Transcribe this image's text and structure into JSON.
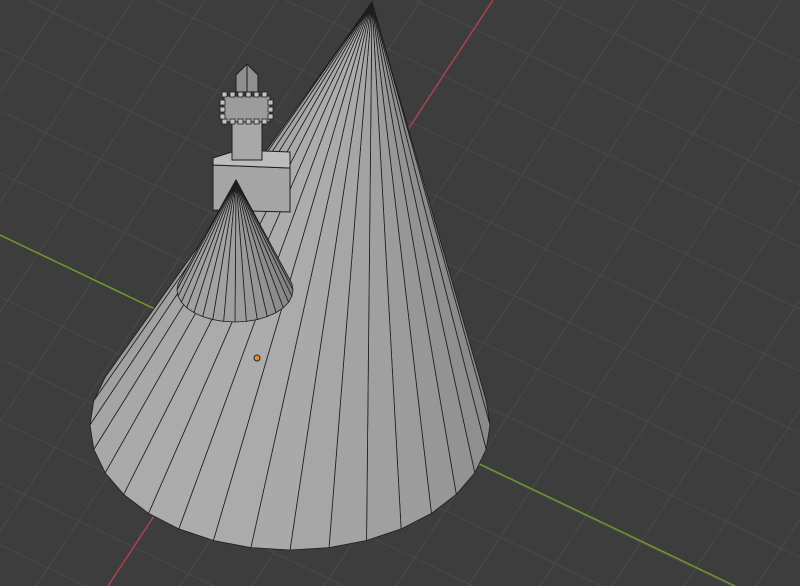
{
  "viewport": {
    "background": "#3d3d3d",
    "grid_color": "#4a4a4a",
    "x_axis_color": "#b0404f",
    "y_axis_color": "#6f9a2a",
    "mesh_color": "#9a9a9a",
    "edge_color": "#1e1e1e",
    "origin_color": "#f08a24",
    "big_cone_segments": 32,
    "small_cone_segments": 32
  }
}
